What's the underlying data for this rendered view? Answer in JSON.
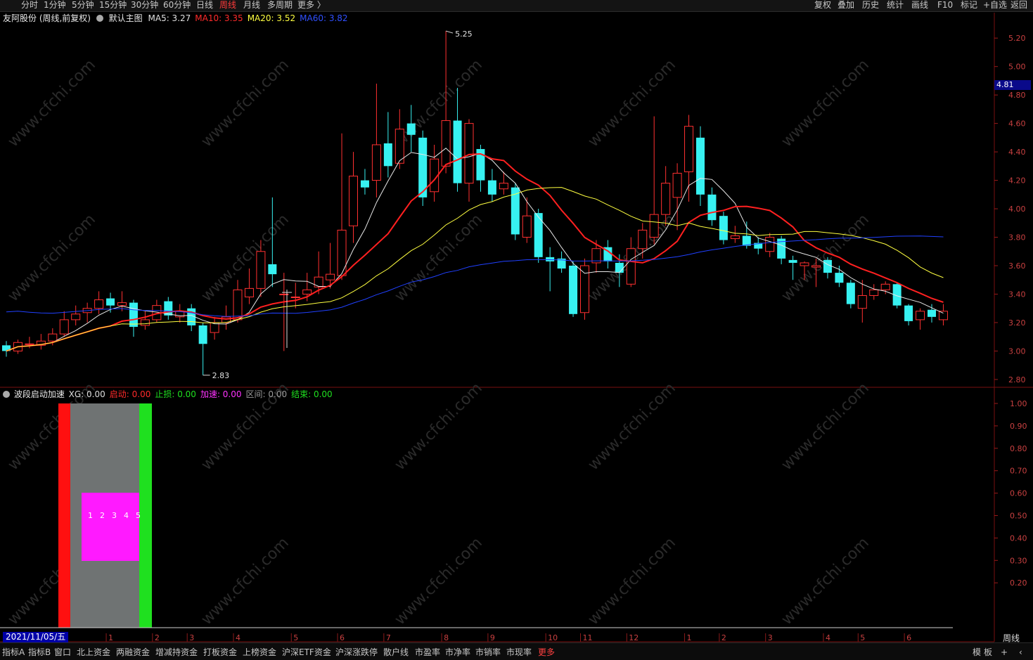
{
  "toolbar": {
    "periods": [
      "分时",
      "1分钟",
      "5分钟",
      "15分钟",
      "30分钟",
      "60分钟",
      "日线",
      "周线",
      "月线",
      "多周期",
      "更多 〉"
    ],
    "active_period": "周线",
    "right_buttons": [
      "复权",
      "叠加",
      "历史",
      "统计",
      "画线",
      "F10",
      "标记",
      "+自选",
      "返回"
    ]
  },
  "main_chart": {
    "stock_title": "友阿股份 (周线,前复权)",
    "template": "默认主图",
    "ma": [
      {
        "label": "MA5: 3.27",
        "color": "#e0e0e0"
      },
      {
        "label": "MA10: 3.35",
        "color": "#ff2a2a"
      },
      {
        "label": "MA20: 3.52",
        "color": "#ffff40"
      },
      {
        "label": "MA60: 3.82",
        "color": "#3050ff"
      }
    ],
    "price_flag": "4.81",
    "high_label": "5.25",
    "low_label": "2.83",
    "y_ticks": [
      "5.20",
      "5.00",
      "4.80",
      "4.60",
      "4.40",
      "4.20",
      "4.00",
      "3.80",
      "3.60",
      "3.40",
      "3.20",
      "3.00",
      "2.80"
    ]
  },
  "chart_data": {
    "type": "candlestick",
    "ylim": [
      2.75,
      5.28
    ],
    "candles": [
      {
        "o": 3.04,
        "c": 3.0,
        "h": 3.07,
        "l": 2.96
      },
      {
        "o": 3.0,
        "c": 3.06,
        "h": 3.08,
        "l": 2.98
      },
      {
        "o": 3.05,
        "c": 3.05,
        "h": 3.1,
        "l": 3.02
      },
      {
        "o": 3.04,
        "c": 3.07,
        "h": 3.12,
        "l": 3.01
      },
      {
        "o": 3.07,
        "c": 3.12,
        "h": 3.16,
        "l": 3.04
      },
      {
        "o": 3.12,
        "c": 3.22,
        "h": 3.28,
        "l": 3.1
      },
      {
        "o": 3.22,
        "c": 3.26,
        "h": 3.32,
        "l": 3.18
      },
      {
        "o": 3.27,
        "c": 3.3,
        "h": 3.34,
        "l": 3.2
      },
      {
        "o": 3.3,
        "c": 3.36,
        "h": 3.42,
        "l": 3.26
      },
      {
        "o": 3.37,
        "c": 3.32,
        "h": 3.41,
        "l": 3.27
      },
      {
        "o": 3.32,
        "c": 3.34,
        "h": 3.42,
        "l": 3.28
      },
      {
        "o": 3.34,
        "c": 3.17,
        "h": 3.36,
        "l": 3.1
      },
      {
        "o": 3.18,
        "c": 3.22,
        "h": 3.28,
        "l": 3.15
      },
      {
        "o": 3.22,
        "c": 3.32,
        "h": 3.36,
        "l": 3.2
      },
      {
        "o": 3.35,
        "c": 3.25,
        "h": 3.38,
        "l": 3.22
      },
      {
        "o": 3.24,
        "c": 3.28,
        "h": 3.33,
        "l": 3.2
      },
      {
        "o": 3.3,
        "c": 3.18,
        "h": 3.33,
        "l": 3.14
      },
      {
        "o": 3.18,
        "c": 3.05,
        "h": 3.2,
        "l": 2.83
      },
      {
        "o": 3.13,
        "c": 3.2,
        "h": 3.24,
        "l": 3.08
      },
      {
        "o": 3.2,
        "c": 3.24,
        "h": 3.32,
        "l": 3.15
      },
      {
        "o": 3.22,
        "c": 3.43,
        "h": 3.5,
        "l": 3.2
      },
      {
        "o": 3.38,
        "c": 3.44,
        "h": 3.58,
        "l": 3.33
      },
      {
        "o": 3.44,
        "c": 3.7,
        "h": 3.78,
        "l": 3.38
      },
      {
        "o": 3.61,
        "c": 3.54,
        "h": 4.08,
        "l": 3.45
      },
      {
        "o": 3.4,
        "c": 3.4,
        "h": 3.55,
        "l": 3.0
      },
      {
        "o": 3.38,
        "c": 3.38,
        "h": 3.48,
        "l": 3.3
      },
      {
        "o": 3.4,
        "c": 3.43,
        "h": 3.55,
        "l": 3.35
      },
      {
        "o": 3.45,
        "c": 3.52,
        "h": 3.7,
        "l": 3.4
      },
      {
        "o": 3.5,
        "c": 3.54,
        "h": 3.76,
        "l": 3.44
      },
      {
        "o": 3.53,
        "c": 3.85,
        "h": 4.53,
        "l": 3.5
      },
      {
        "o": 3.88,
        "c": 4.23,
        "h": 4.4,
        "l": 3.76
      },
      {
        "o": 4.2,
        "c": 4.15,
        "h": 4.28,
        "l": 4.1
      },
      {
        "o": 4.2,
        "c": 4.45,
        "h": 4.88,
        "l": 4.08
      },
      {
        "o": 4.46,
        "c": 4.3,
        "h": 4.68,
        "l": 4.22
      },
      {
        "o": 4.32,
        "c": 4.56,
        "h": 4.7,
        "l": 4.28
      },
      {
        "o": 4.6,
        "c": 4.52,
        "h": 4.73,
        "l": 4.4
      },
      {
        "o": 4.5,
        "c": 4.08,
        "h": 4.55,
        "l": 4.02
      },
      {
        "o": 4.12,
        "c": 4.35,
        "h": 4.45,
        "l": 4.05
      },
      {
        "o": 4.3,
        "c": 4.62,
        "h": 5.25,
        "l": 4.25
      },
      {
        "o": 4.62,
        "c": 4.18,
        "h": 4.85,
        "l": 4.12
      },
      {
        "o": 4.18,
        "c": 4.6,
        "h": 4.63,
        "l": 4.05
      },
      {
        "o": 4.42,
        "c": 4.2,
        "h": 4.45,
        "l": 4.12
      },
      {
        "o": 4.2,
        "c": 4.1,
        "h": 4.28,
        "l": 4.05
      },
      {
        "o": 4.14,
        "c": 4.18,
        "h": 4.26,
        "l": 4.1
      },
      {
        "o": 4.15,
        "c": 3.82,
        "h": 4.18,
        "l": 3.78
      },
      {
        "o": 3.8,
        "c": 3.95,
        "h": 4.08,
        "l": 3.76
      },
      {
        "o": 3.97,
        "c": 3.66,
        "h": 4.0,
        "l": 3.62
      },
      {
        "o": 3.66,
        "c": 3.63,
        "h": 3.73,
        "l": 3.42
      },
      {
        "o": 3.65,
        "c": 3.58,
        "h": 3.7,
        "l": 3.55
      },
      {
        "o": 3.6,
        "c": 3.26,
        "h": 3.63,
        "l": 3.24
      },
      {
        "o": 3.27,
        "c": 3.6,
        "h": 3.65,
        "l": 3.22
      },
      {
        "o": 3.62,
        "c": 3.72,
        "h": 3.78,
        "l": 3.55
      },
      {
        "o": 3.73,
        "c": 3.63,
        "h": 3.78,
        "l": 3.58
      },
      {
        "o": 3.62,
        "c": 3.55,
        "h": 3.68,
        "l": 3.45
      },
      {
        "o": 3.47,
        "c": 3.72,
        "h": 3.8,
        "l": 3.45
      },
      {
        "o": 3.72,
        "c": 3.85,
        "h": 3.9,
        "l": 3.65
      },
      {
        "o": 3.8,
        "c": 3.96,
        "h": 4.65,
        "l": 3.75
      },
      {
        "o": 3.96,
        "c": 4.18,
        "h": 4.3,
        "l": 3.88
      },
      {
        "o": 4.08,
        "c": 4.25,
        "h": 4.32,
        "l": 3.85
      },
      {
        "o": 4.26,
        "c": 4.58,
        "h": 4.66,
        "l": 4.05
      },
      {
        "o": 4.5,
        "c": 4.1,
        "h": 4.58,
        "l": 4.02
      },
      {
        "o": 4.1,
        "c": 3.92,
        "h": 4.15,
        "l": 3.88
      },
      {
        "o": 3.95,
        "c": 3.78,
        "h": 3.98,
        "l": 3.75
      },
      {
        "o": 3.79,
        "c": 3.81,
        "h": 3.88,
        "l": 3.76
      },
      {
        "o": 3.81,
        "c": 3.74,
        "h": 3.91,
        "l": 3.72
      },
      {
        "o": 3.76,
        "c": 3.72,
        "h": 3.8,
        "l": 3.68
      },
      {
        "o": 3.7,
        "c": 3.8,
        "h": 3.83,
        "l": 3.66
      },
      {
        "o": 3.79,
        "c": 3.65,
        "h": 3.81,
        "l": 3.61
      },
      {
        "o": 3.64,
        "c": 3.62,
        "h": 3.67,
        "l": 3.5
      },
      {
        "o": 3.6,
        "c": 3.62,
        "h": 3.63,
        "l": 3.5
      },
      {
        "o": 3.59,
        "c": 3.6,
        "h": 3.65,
        "l": 3.45
      },
      {
        "o": 3.64,
        "c": 3.55,
        "h": 3.66,
        "l": 3.51
      },
      {
        "o": 3.55,
        "c": 3.48,
        "h": 3.6,
        "l": 3.45
      },
      {
        "o": 3.48,
        "c": 3.33,
        "h": 3.5,
        "l": 3.3
      },
      {
        "o": 3.3,
        "c": 3.39,
        "h": 3.5,
        "l": 3.2
      },
      {
        "o": 3.39,
        "c": 3.43,
        "h": 3.47,
        "l": 3.36
      },
      {
        "o": 3.43,
        "c": 3.47,
        "h": 3.49,
        "l": 3.4
      },
      {
        "o": 3.47,
        "c": 3.32,
        "h": 3.48,
        "l": 3.3
      },
      {
        "o": 3.32,
        "c": 3.21,
        "h": 3.33,
        "l": 3.18
      },
      {
        "o": 3.22,
        "c": 3.28,
        "h": 3.3,
        "l": 3.15
      },
      {
        "o": 3.29,
        "c": 3.24,
        "h": 3.33,
        "l": 3.2
      },
      {
        "o": 3.22,
        "c": 3.28,
        "h": 3.33,
        "l": 3.18
      }
    ]
  },
  "x_ticks": [
    "1",
    "2",
    "3",
    "4",
    "5",
    "6",
    "7",
    "8",
    "9",
    "10",
    "11",
    "12",
    "1",
    "2",
    "3",
    "4",
    "5",
    "6"
  ],
  "sub_chart": {
    "title": "波段启动加速",
    "fields": [
      {
        "label": "XG: 0.00",
        "color": "#ddd"
      },
      {
        "label": "启动: 0.00",
        "color": "#ff2a2a"
      },
      {
        "label": "止损: 0.00",
        "color": "#1fe01f"
      },
      {
        "label": "加速: 0.00",
        "color": "#ff33ff"
      },
      {
        "label": "区间: 0.00",
        "color": "#9a9a9a"
      },
      {
        "label": "结束: 0.00",
        "color": "#1fe01f"
      }
    ],
    "counter_labels": [
      "1",
      "2",
      "3",
      "4",
      "5"
    ],
    "y_ticks": [
      "1.00",
      "0.90",
      "0.80",
      "0.70",
      "0.60",
      "0.50",
      "0.40",
      "0.30",
      "0.20"
    ]
  },
  "footer": {
    "date": "2021/11/05/五",
    "period": "周线",
    "tabs": [
      "指标A",
      "指标B",
      "窗口",
      "北上资金",
      "两融资金",
      "增减持资金",
      "打板资金",
      "上榜资金",
      "沪深ETF资金",
      "沪深涨跌停",
      "散户线",
      "市盈率",
      "市净率",
      "市销率",
      "市现率",
      "更多"
    ],
    "right_buttons": [
      "模",
      "板",
      "+",
      "‹"
    ]
  },
  "watermark": "www.cfchi.com"
}
